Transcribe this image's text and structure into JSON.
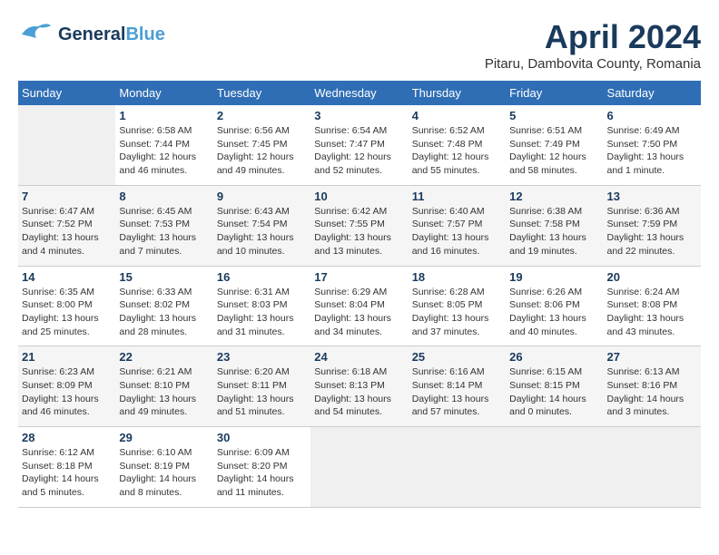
{
  "header": {
    "logo_general": "General",
    "logo_blue": "Blue",
    "month": "April 2024",
    "location": "Pitaru, Dambovita County, Romania"
  },
  "days_of_week": [
    "Sunday",
    "Monday",
    "Tuesday",
    "Wednesday",
    "Thursday",
    "Friday",
    "Saturday"
  ],
  "weeks": [
    [
      {
        "day": "",
        "info": ""
      },
      {
        "day": "1",
        "info": "Sunrise: 6:58 AM\nSunset: 7:44 PM\nDaylight: 12 hours\nand 46 minutes."
      },
      {
        "day": "2",
        "info": "Sunrise: 6:56 AM\nSunset: 7:45 PM\nDaylight: 12 hours\nand 49 minutes."
      },
      {
        "day": "3",
        "info": "Sunrise: 6:54 AM\nSunset: 7:47 PM\nDaylight: 12 hours\nand 52 minutes."
      },
      {
        "day": "4",
        "info": "Sunrise: 6:52 AM\nSunset: 7:48 PM\nDaylight: 12 hours\nand 55 minutes."
      },
      {
        "day": "5",
        "info": "Sunrise: 6:51 AM\nSunset: 7:49 PM\nDaylight: 12 hours\nand 58 minutes."
      },
      {
        "day": "6",
        "info": "Sunrise: 6:49 AM\nSunset: 7:50 PM\nDaylight: 13 hours\nand 1 minute."
      }
    ],
    [
      {
        "day": "7",
        "info": "Sunrise: 6:47 AM\nSunset: 7:52 PM\nDaylight: 13 hours\nand 4 minutes."
      },
      {
        "day": "8",
        "info": "Sunrise: 6:45 AM\nSunset: 7:53 PM\nDaylight: 13 hours\nand 7 minutes."
      },
      {
        "day": "9",
        "info": "Sunrise: 6:43 AM\nSunset: 7:54 PM\nDaylight: 13 hours\nand 10 minutes."
      },
      {
        "day": "10",
        "info": "Sunrise: 6:42 AM\nSunset: 7:55 PM\nDaylight: 13 hours\nand 13 minutes."
      },
      {
        "day": "11",
        "info": "Sunrise: 6:40 AM\nSunset: 7:57 PM\nDaylight: 13 hours\nand 16 minutes."
      },
      {
        "day": "12",
        "info": "Sunrise: 6:38 AM\nSunset: 7:58 PM\nDaylight: 13 hours\nand 19 minutes."
      },
      {
        "day": "13",
        "info": "Sunrise: 6:36 AM\nSunset: 7:59 PM\nDaylight: 13 hours\nand 22 minutes."
      }
    ],
    [
      {
        "day": "14",
        "info": "Sunrise: 6:35 AM\nSunset: 8:00 PM\nDaylight: 13 hours\nand 25 minutes."
      },
      {
        "day": "15",
        "info": "Sunrise: 6:33 AM\nSunset: 8:02 PM\nDaylight: 13 hours\nand 28 minutes."
      },
      {
        "day": "16",
        "info": "Sunrise: 6:31 AM\nSunset: 8:03 PM\nDaylight: 13 hours\nand 31 minutes."
      },
      {
        "day": "17",
        "info": "Sunrise: 6:29 AM\nSunset: 8:04 PM\nDaylight: 13 hours\nand 34 minutes."
      },
      {
        "day": "18",
        "info": "Sunrise: 6:28 AM\nSunset: 8:05 PM\nDaylight: 13 hours\nand 37 minutes."
      },
      {
        "day": "19",
        "info": "Sunrise: 6:26 AM\nSunset: 8:06 PM\nDaylight: 13 hours\nand 40 minutes."
      },
      {
        "day": "20",
        "info": "Sunrise: 6:24 AM\nSunset: 8:08 PM\nDaylight: 13 hours\nand 43 minutes."
      }
    ],
    [
      {
        "day": "21",
        "info": "Sunrise: 6:23 AM\nSunset: 8:09 PM\nDaylight: 13 hours\nand 46 minutes."
      },
      {
        "day": "22",
        "info": "Sunrise: 6:21 AM\nSunset: 8:10 PM\nDaylight: 13 hours\nand 49 minutes."
      },
      {
        "day": "23",
        "info": "Sunrise: 6:20 AM\nSunset: 8:11 PM\nDaylight: 13 hours\nand 51 minutes."
      },
      {
        "day": "24",
        "info": "Sunrise: 6:18 AM\nSunset: 8:13 PM\nDaylight: 13 hours\nand 54 minutes."
      },
      {
        "day": "25",
        "info": "Sunrise: 6:16 AM\nSunset: 8:14 PM\nDaylight: 13 hours\nand 57 minutes."
      },
      {
        "day": "26",
        "info": "Sunrise: 6:15 AM\nSunset: 8:15 PM\nDaylight: 14 hours\nand 0 minutes."
      },
      {
        "day": "27",
        "info": "Sunrise: 6:13 AM\nSunset: 8:16 PM\nDaylight: 14 hours\nand 3 minutes."
      }
    ],
    [
      {
        "day": "28",
        "info": "Sunrise: 6:12 AM\nSunset: 8:18 PM\nDaylight: 14 hours\nand 5 minutes."
      },
      {
        "day": "29",
        "info": "Sunrise: 6:10 AM\nSunset: 8:19 PM\nDaylight: 14 hours\nand 8 minutes."
      },
      {
        "day": "30",
        "info": "Sunrise: 6:09 AM\nSunset: 8:20 PM\nDaylight: 14 hours\nand 11 minutes."
      },
      {
        "day": "",
        "info": ""
      },
      {
        "day": "",
        "info": ""
      },
      {
        "day": "",
        "info": ""
      },
      {
        "day": "",
        "info": ""
      }
    ]
  ]
}
